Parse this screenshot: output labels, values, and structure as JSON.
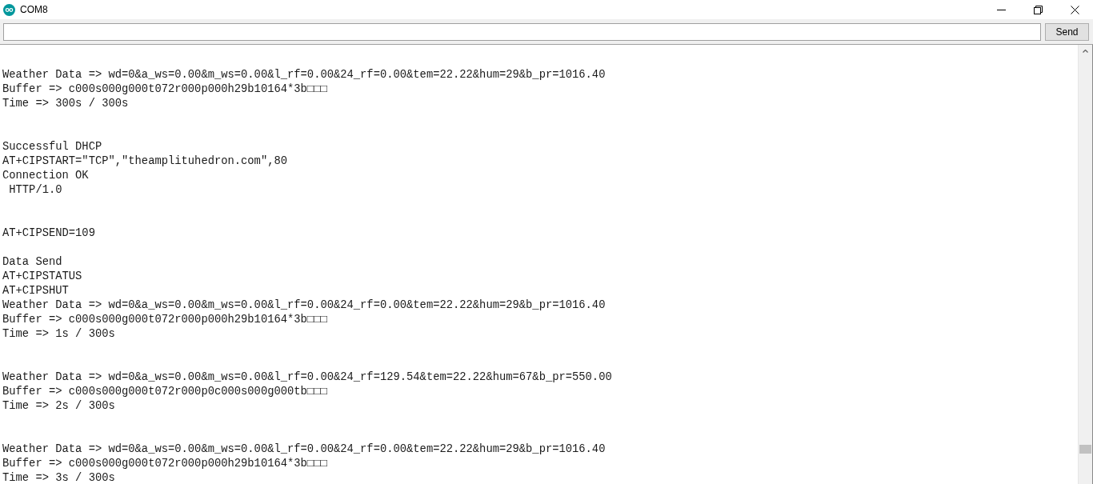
{
  "window": {
    "title": "COM8"
  },
  "send_button": {
    "label": "Send"
  },
  "output_lines": [
    {
      "kind": "blank"
    },
    {
      "kind": "text",
      "text": "Weather Data => wd=0&a_ws=0.00&m_ws=0.00&l_rf=0.00&24_rf=0.00&tem=22.22&hum=29&b_pr=1016.40"
    },
    {
      "kind": "text",
      "text": "Buffer => c000s000g000t072r000p000h29b10164*3b□□□"
    },
    {
      "kind": "text",
      "text": "Time => 300s / 300s"
    },
    {
      "kind": "blank"
    },
    {
      "kind": "blank"
    },
    {
      "kind": "text",
      "text": "Successful DHCP"
    },
    {
      "kind": "text",
      "text": "AT+CIPSTART=\"TCP\",\"theamplituhedron.com\",80"
    },
    {
      "kind": "text",
      "text": "Connection OK"
    },
    {
      "kind": "text",
      "text": " HTTP/1.0"
    },
    {
      "kind": "blank"
    },
    {
      "kind": "blank"
    },
    {
      "kind": "text",
      "text": "AT+CIPSEND=109"
    },
    {
      "kind": "blank"
    },
    {
      "kind": "text",
      "text": "Data Send"
    },
    {
      "kind": "text",
      "text": "AT+CIPSTATUS"
    },
    {
      "kind": "text",
      "text": "AT+CIPSHUT"
    },
    {
      "kind": "text",
      "text": "Weather Data => wd=0&a_ws=0.00&m_ws=0.00&l_rf=0.00&24_rf=0.00&tem=22.22&hum=29&b_pr=1016.40"
    },
    {
      "kind": "text",
      "text": "Buffer => c000s000g000t072r000p000h29b10164*3b□□□"
    },
    {
      "kind": "text",
      "text": "Time => 1s / 300s"
    },
    {
      "kind": "blank"
    },
    {
      "kind": "blank"
    },
    {
      "kind": "text",
      "text": "Weather Data => wd=0&a_ws=0.00&m_ws=0.00&l_rf=0.00&24_rf=129.54&tem=22.22&hum=67&b_pr=550.00"
    },
    {
      "kind": "text",
      "text": "Buffer => c000s000g000t072r000p0c000s000g000tb□□□"
    },
    {
      "kind": "text",
      "text": "Time => 2s / 300s"
    },
    {
      "kind": "blank"
    },
    {
      "kind": "blank"
    },
    {
      "kind": "text",
      "text": "Weather Data => wd=0&a_ws=0.00&m_ws=0.00&l_rf=0.00&24_rf=0.00&tem=22.22&hum=29&b_pr=1016.40"
    },
    {
      "kind": "text",
      "text": "Buffer => c000s000g000t072r000p000h29b10164*3b□□□"
    },
    {
      "kind": "text",
      "text": "Time => 3s / 300s"
    }
  ]
}
